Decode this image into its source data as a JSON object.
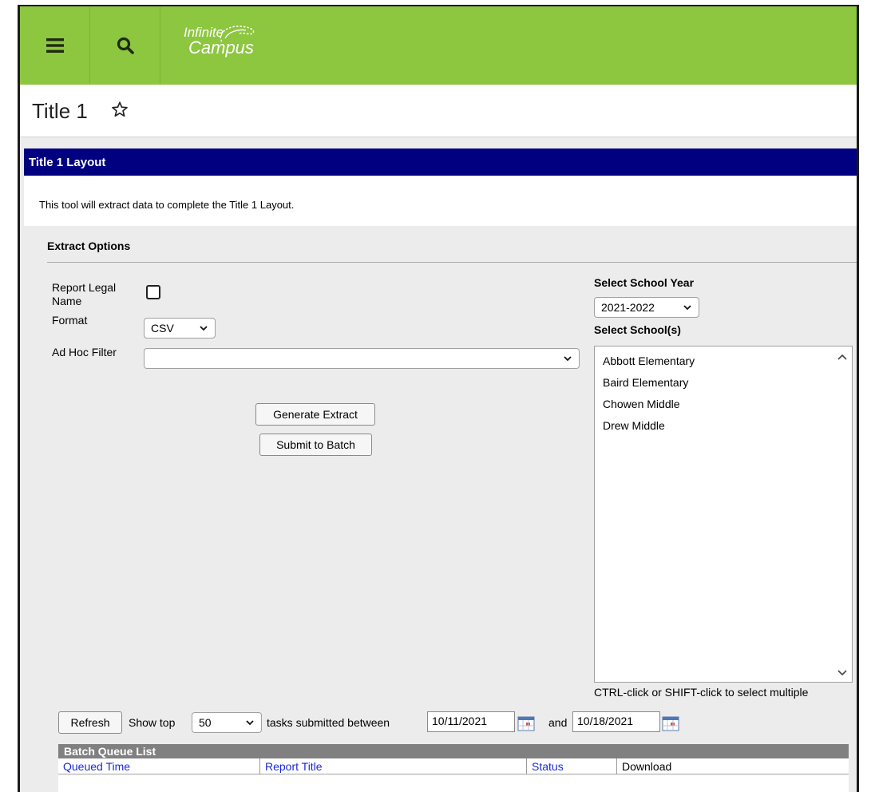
{
  "app": {
    "logo_line1": "Infinite",
    "logo_line2": "Campus",
    "colors": {
      "topbar": "#8dc63f",
      "section_header": "#000080",
      "link": "#1a2ad8"
    }
  },
  "header": {
    "menu_icon": "hamburger-menu-icon",
    "search_icon": "search-icon",
    "page_title": "Title 1",
    "favorite_icon": "star-outline-icon"
  },
  "section": {
    "title": "Title 1 Layout",
    "description": "This tool will extract data to complete the Title 1 Layout."
  },
  "extract_options": {
    "title": "Extract Options",
    "report_legal_name_label_1": "Report Legal",
    "report_legal_name_label_2": "Name",
    "report_legal_name_checked": false,
    "format_label": "Format",
    "format_value": "CSV",
    "ad_hoc_label": "Ad Hoc Filter",
    "ad_hoc_value": "",
    "generate_button": "Generate Extract",
    "submit_button": "Submit to Batch"
  },
  "school": {
    "year_label": "Select School Year",
    "year_value": "2021-2022",
    "schools_label": "Select School(s)",
    "schools": [
      "Abbott Elementary",
      "Baird Elementary",
      "Chowen Middle",
      "Drew Middle"
    ],
    "hint": "CTRL-click or SHIFT-click to select multiple"
  },
  "batch": {
    "refresh_button": "Refresh",
    "show_top_label": "Show top",
    "show_top_value": "50",
    "between_label": "tasks submitted between",
    "start_date": "10/11/2021",
    "and_label": "and",
    "end_date": "10/18/2021",
    "list_title": "Batch Queue List",
    "columns": [
      "Queued Time",
      "Report Title",
      "Status",
      "Download"
    ]
  }
}
